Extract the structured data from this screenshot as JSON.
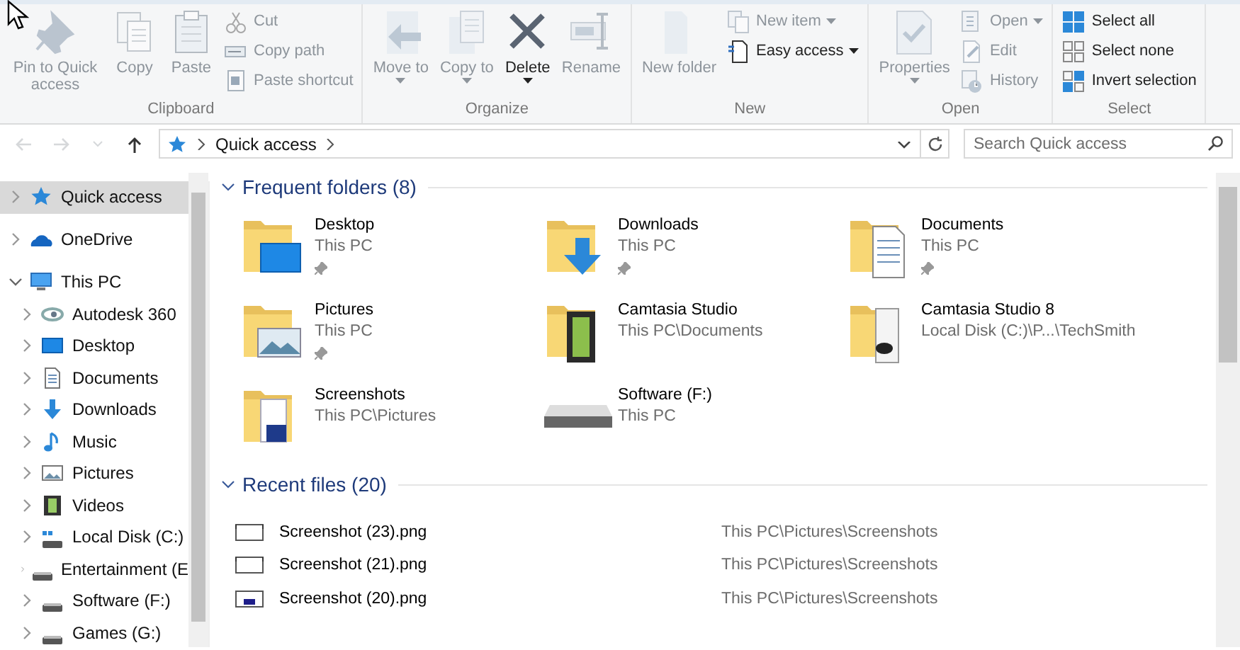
{
  "ribbon": {
    "groups": [
      {
        "label": "Clipboard",
        "items": [
          {
            "label": "Pin to Quick access",
            "kind": "large",
            "disabled": true,
            "dropdown": false
          },
          {
            "label": "Copy",
            "kind": "large",
            "disabled": true,
            "dropdown": false
          },
          {
            "label": "Paste",
            "kind": "large",
            "disabled": true,
            "dropdown": false
          },
          {
            "label": "Cut",
            "kind": "small",
            "disabled": true,
            "dropdown": false
          },
          {
            "label": "Copy path",
            "kind": "small",
            "disabled": true,
            "dropdown": false
          },
          {
            "label": "Paste shortcut",
            "kind": "small",
            "disabled": true,
            "dropdown": false
          }
        ]
      },
      {
        "label": "Organize",
        "items": [
          {
            "label": "Move to",
            "kind": "large",
            "disabled": true,
            "dropdown": true
          },
          {
            "label": "Copy to",
            "kind": "large",
            "disabled": true,
            "dropdown": true
          },
          {
            "label": "Delete",
            "kind": "large",
            "disabled": false,
            "dropdown": true
          },
          {
            "label": "Rename",
            "kind": "large",
            "disabled": true,
            "dropdown": false
          }
        ]
      },
      {
        "label": "New",
        "items": [
          {
            "label": "New folder",
            "kind": "large",
            "disabled": true,
            "dropdown": false
          },
          {
            "label": "New item",
            "kind": "small",
            "disabled": true,
            "dropdown": true
          },
          {
            "label": "Easy access",
            "kind": "small",
            "disabled": false,
            "dropdown": true
          }
        ]
      },
      {
        "label": "Open",
        "items": [
          {
            "label": "Properties",
            "kind": "large",
            "disabled": true,
            "dropdown": true
          },
          {
            "label": "Open",
            "kind": "small",
            "disabled": true,
            "dropdown": true
          },
          {
            "label": "Edit",
            "kind": "small",
            "disabled": true,
            "dropdown": false
          },
          {
            "label": "History",
            "kind": "small",
            "disabled": true,
            "dropdown": false
          }
        ]
      },
      {
        "label": "Select",
        "items": [
          {
            "label": "Select all",
            "kind": "small",
            "disabled": false,
            "dropdown": false
          },
          {
            "label": "Select none",
            "kind": "small",
            "disabled": false,
            "dropdown": false
          },
          {
            "label": "Invert selection",
            "kind": "small",
            "disabled": false,
            "dropdown": false
          }
        ]
      }
    ]
  },
  "address_bar": {
    "back_disabled": true,
    "forward_disabled": true,
    "path": [
      "Quick access"
    ]
  },
  "search": {
    "placeholder": "Search Quick access"
  },
  "sidebar": {
    "items": [
      {
        "label": "Quick access",
        "kind": "star",
        "selected": true,
        "expanded": false
      },
      {
        "label": "OneDrive",
        "kind": "cloud",
        "selected": false,
        "expanded": false
      },
      {
        "label": "This PC",
        "kind": "pc",
        "selected": false,
        "expanded": true,
        "children": [
          {
            "label": "Autodesk 360",
            "kind": "autodesk",
            "selected": false,
            "expanded": false
          },
          {
            "label": "Desktop",
            "kind": "desktop",
            "selected": false,
            "expanded": false
          },
          {
            "label": "Documents",
            "kind": "documents",
            "selected": false,
            "expanded": false
          },
          {
            "label": "Downloads",
            "kind": "downloads",
            "selected": false,
            "expanded": false
          },
          {
            "label": "Music",
            "kind": "music",
            "selected": false,
            "expanded": false
          },
          {
            "label": "Pictures",
            "kind": "pictures",
            "selected": false,
            "expanded": false
          },
          {
            "label": "Videos",
            "kind": "videos",
            "selected": false,
            "expanded": false
          },
          {
            "label": "Local Disk (C:)",
            "kind": "system-disk",
            "selected": false,
            "expanded": false
          },
          {
            "label": "Entertainment (E",
            "kind": "drive",
            "selected": false,
            "expanded": false
          },
          {
            "label": "Software (F:)",
            "kind": "drive",
            "selected": false,
            "expanded": false
          },
          {
            "label": "Games (G:)",
            "kind": "drive",
            "selected": false,
            "expanded": false
          }
        ]
      }
    ]
  },
  "sections": [
    {
      "title": "Frequent folders (8)",
      "kind": "tiles",
      "expanded": true,
      "items": [
        {
          "name": "Desktop",
          "location": "This PC",
          "kind": "desktop",
          "pinned": true
        },
        {
          "name": "Downloads",
          "location": "This PC",
          "kind": "downloads",
          "pinned": true
        },
        {
          "name": "Documents",
          "location": "This PC",
          "kind": "documents",
          "pinned": true
        },
        {
          "name": "Pictures",
          "location": "This PC",
          "kind": "pictures",
          "pinned": true
        },
        {
          "name": "Camtasia Studio",
          "location": "This PC\\Documents",
          "kind": "film",
          "pinned": false
        },
        {
          "name": "Camtasia Studio 8",
          "location": "Local Disk (C:)\\P...\\TechSmith",
          "kind": "media",
          "pinned": false
        },
        {
          "name": "Screenshots",
          "location": "This PC\\Pictures",
          "kind": "screens",
          "pinned": false
        },
        {
          "name": "Software (F:)",
          "location": "This PC",
          "kind": "drive",
          "pinned": false
        }
      ]
    },
    {
      "title": "Recent files (20)",
      "kind": "list",
      "expanded": true,
      "items": [
        {
          "name": "Screenshot (23).png",
          "location": "This PC\\Pictures\\Screenshots",
          "kind": "blank"
        },
        {
          "name": "Screenshot (21).png",
          "location": "This PC\\Pictures\\Screenshots",
          "kind": "blank"
        },
        {
          "name": "Screenshot (20).png",
          "location": "This PC\\Pictures\\Screenshots",
          "kind": "dark"
        }
      ]
    }
  ]
}
